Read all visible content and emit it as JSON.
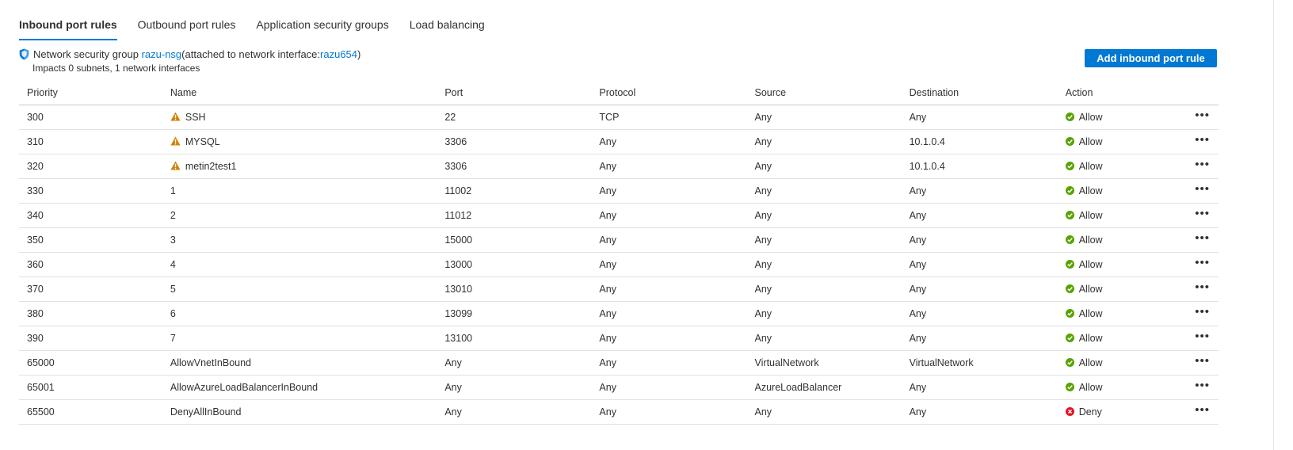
{
  "tabs": [
    {
      "label": "Inbound port rules",
      "active": true
    },
    {
      "label": "Outbound port rules",
      "active": false
    },
    {
      "label": "Application security groups",
      "active": false
    },
    {
      "label": "Load balancing",
      "active": false
    }
  ],
  "nsg": {
    "prefix": "Network security group ",
    "name": "razu-nsg",
    "middle": " (attached to network interface: ",
    "nic": "razu654",
    "suffix": ")",
    "impacts": "Impacts 0 subnets, 1 network interfaces"
  },
  "add_button": "Add inbound port rule",
  "columns": [
    "Priority",
    "Name",
    "Port",
    "Protocol",
    "Source",
    "Destination",
    "Action"
  ],
  "rows": [
    {
      "priority": "300",
      "name": "SSH",
      "warning": true,
      "port": "22",
      "protocol": "TCP",
      "source": "Any",
      "destination": "Any",
      "action": "Allow"
    },
    {
      "priority": "310",
      "name": "MYSQL",
      "warning": true,
      "port": "3306",
      "protocol": "Any",
      "source": "Any",
      "destination": "10.1.0.4",
      "action": "Allow"
    },
    {
      "priority": "320",
      "name": "metin2test1",
      "warning": true,
      "port": "3306",
      "protocol": "Any",
      "source": "Any",
      "destination": "10.1.0.4",
      "action": "Allow"
    },
    {
      "priority": "330",
      "name": "1",
      "warning": false,
      "port": "11002",
      "protocol": "Any",
      "source": "Any",
      "destination": "Any",
      "action": "Allow"
    },
    {
      "priority": "340",
      "name": "2",
      "warning": false,
      "port": "11012",
      "protocol": "Any",
      "source": "Any",
      "destination": "Any",
      "action": "Allow"
    },
    {
      "priority": "350",
      "name": "3",
      "warning": false,
      "port": "15000",
      "protocol": "Any",
      "source": "Any",
      "destination": "Any",
      "action": "Allow"
    },
    {
      "priority": "360",
      "name": "4",
      "warning": false,
      "port": "13000",
      "protocol": "Any",
      "source": "Any",
      "destination": "Any",
      "action": "Allow"
    },
    {
      "priority": "370",
      "name": "5",
      "warning": false,
      "port": "13010",
      "protocol": "Any",
      "source": "Any",
      "destination": "Any",
      "action": "Allow"
    },
    {
      "priority": "380",
      "name": "6",
      "warning": false,
      "port": "13099",
      "protocol": "Any",
      "source": "Any",
      "destination": "Any",
      "action": "Allow"
    },
    {
      "priority": "390",
      "name": "7",
      "warning": false,
      "port": "13100",
      "protocol": "Any",
      "source": "Any",
      "destination": "Any",
      "action": "Allow"
    },
    {
      "priority": "65000",
      "name": "AllowVnetInBound",
      "warning": false,
      "port": "Any",
      "protocol": "Any",
      "source": "VirtualNetwork",
      "destination": "VirtualNetwork",
      "action": "Allow"
    },
    {
      "priority": "65001",
      "name": "AllowAzureLoadBalancerInBound",
      "warning": false,
      "port": "Any",
      "protocol": "Any",
      "source": "AzureLoadBalancer",
      "destination": "Any",
      "action": "Allow"
    },
    {
      "priority": "65500",
      "name": "DenyAllInBound",
      "warning": false,
      "port": "Any",
      "protocol": "Any",
      "source": "Any",
      "destination": "Any",
      "action": "Deny"
    }
  ],
  "row_menu_glyph": "•••",
  "colors": {
    "accent": "#0078d4",
    "allow": "#57a300",
    "deny": "#e81123",
    "warning": "#d67f05"
  },
  "icons": {
    "shield": "shield-icon",
    "warning": "warning-icon",
    "allow": "check-circle-icon",
    "deny": "error-circle-icon",
    "more": "more-icon"
  }
}
